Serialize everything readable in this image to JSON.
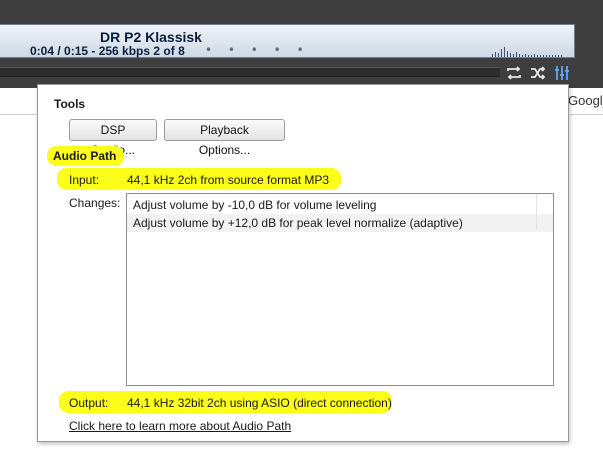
{
  "player": {
    "station_title": "DR P2 Klassisk",
    "status": "0:04 / 0:15 - 256 kbps   2 of 8",
    "dots": "• • • • •"
  },
  "toolbar": {
    "icons": [
      "repeat-icon",
      "shuffle-icon",
      "equalizer-icon"
    ]
  },
  "background": {
    "partial_text": "Googl"
  },
  "panel": {
    "tools_title": "Tools",
    "dsp_button": "DSP Studio...",
    "playback_button": "Playback Options...",
    "audio_path_title": "Audio Path",
    "input_label": "Input:",
    "input_value": "44,1 kHz 2ch from source format MP3",
    "changes_label": "Changes:",
    "changes": [
      "Adjust volume by -10,0 dB for volume leveling",
      "Adjust volume by +12,0 dB for peak level normalize (adaptive)"
    ],
    "output_label": "Output:",
    "output_value": "44,1 kHz 32bit 2ch using ASIO (direct connection)",
    "learn_more_link": "Click here to learn more about Audio Path"
  },
  "colors": {
    "highlight": "#fbff19",
    "accent_active_icon": "#5aa8ff"
  }
}
